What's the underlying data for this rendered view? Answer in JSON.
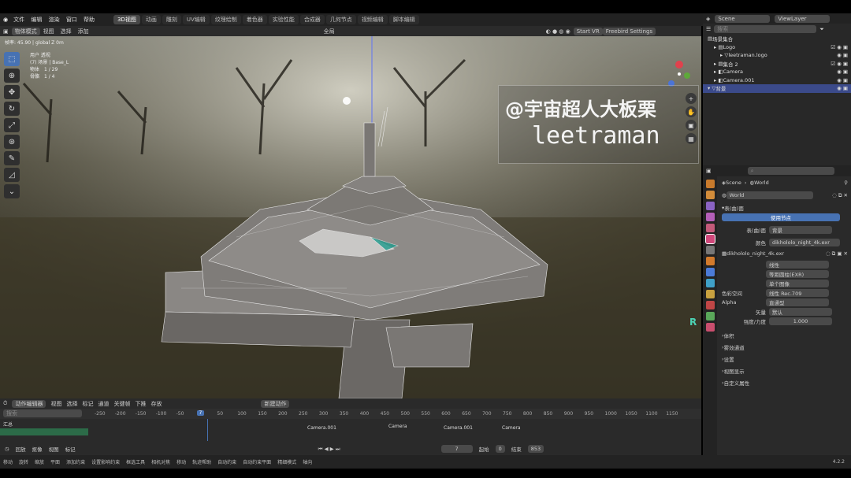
{
  "menu": {
    "items": [
      "文件",
      "编辑",
      "渲染",
      "窗口",
      "帮助"
    ]
  },
  "workspace_tabs": [
    "3D视图",
    "动画",
    "雕刻",
    "UV编辑",
    "纹理绘制",
    "着色器",
    "实验性能",
    "合成器",
    "几何节点",
    "视频编辑",
    "脚本编辑"
  ],
  "viewport_header": {
    "mode": "物体模式",
    "view": "视图",
    "select": "选择",
    "add": "添加",
    "orientation": "全局",
    "start_vr": "Start VR",
    "freebird": "Freebird Settings"
  },
  "viewport_info": {
    "fps": "帧率: 45.90 | global Z 0m",
    "line1": "用户 透视",
    "line2": "(7) 场景 | Base_L",
    "stats": [
      {
        "label": "物体",
        "value": "1 / 29"
      },
      {
        "label": "骨骼",
        "value": "1 / 4"
      }
    ]
  },
  "overlay_text": {
    "title": "@宇宙超人大板栗",
    "subtitle": "leetraman"
  },
  "axis_letter": "R",
  "outliner": {
    "scene": "Scene",
    "view_layer": "ViewLayer",
    "search_placeholder": "搜索",
    "rows": [
      {
        "label": "场景集合",
        "selected": false
      },
      {
        "label": "Logo",
        "selected": false
      },
      {
        "label": "leetraman.logo",
        "selected": false
      },
      {
        "label": "集合 2",
        "selected": false
      },
      {
        "label": "Camera",
        "selected": false
      },
      {
        "label": "Camera.001",
        "selected": false
      },
      {
        "label": "背景",
        "selected": true
      }
    ]
  },
  "properties": {
    "breadcrumb_scene": "Scene",
    "breadcrumb_world": "World",
    "world_name": "World",
    "surface_section": "表(曲)面",
    "use_nodes": "使用节点",
    "surface_label": "表(曲)面",
    "surface_value": "背景",
    "color_label": "颜色",
    "color_value": "dikhololo_night_4k.exr",
    "image_name": "dikhololo_night_4k.exr",
    "interp": "线性",
    "proj": "等距圆柱(EXR)",
    "ext": "单个图像",
    "colorspace_label": "色彩空间",
    "colorspace_value": "线性 Rec.709",
    "alpha_label": "Alpha",
    "alpha_value": "直通型",
    "vector_label": "矢量",
    "vector_value": "默认",
    "strength_label": "强度/力度",
    "strength_value": "1.000",
    "sections": [
      "体积",
      "雾效通道",
      "设置",
      "视图显示",
      "自定义属性"
    ]
  },
  "timeline": {
    "editor": "动作编辑器",
    "menus": [
      "视图",
      "选择",
      "标记",
      "通道",
      "关键帧"
    ],
    "down": "下推",
    "stash": "存放",
    "new_action": "新建动作",
    "search_placeholder": "搜索",
    "summary": "汇总",
    "ticks": [
      "-250",
      "-200",
      "-150",
      "-100",
      "-50",
      "7",
      "50",
      "100",
      "150",
      "200",
      "250",
      "300",
      "350",
      "400",
      "450",
      "500",
      "550",
      "600",
      "650",
      "700",
      "750",
      "800",
      "850",
      "900",
      "950",
      "1000",
      "1050",
      "1100",
      "1150"
    ],
    "markers": [
      "Camera.001",
      "Camera",
      "Camera.001",
      "Camera"
    ],
    "playback": "回放",
    "keying": "抠像",
    "view": "视图",
    "marker": "标记",
    "current_frame": "7",
    "start_label": "起始",
    "start": "0",
    "end_label": "结束",
    "end": "853"
  },
  "status_bar": {
    "items": [
      "移动",
      "旋转",
      "缩放",
      "平面",
      "添加约束",
      "设置影响约束",
      "框选工具",
      "相机对焦",
      "移动",
      "轨迹帮助",
      "自动约束",
      "自动约束平面",
      "精细模式",
      "轴向"
    ],
    "version": "4.2.2"
  },
  "colors": {
    "accent": "#4772b3",
    "outliner_sel": "#3b4a8a",
    "timeline_green": "#2c6b48"
  }
}
